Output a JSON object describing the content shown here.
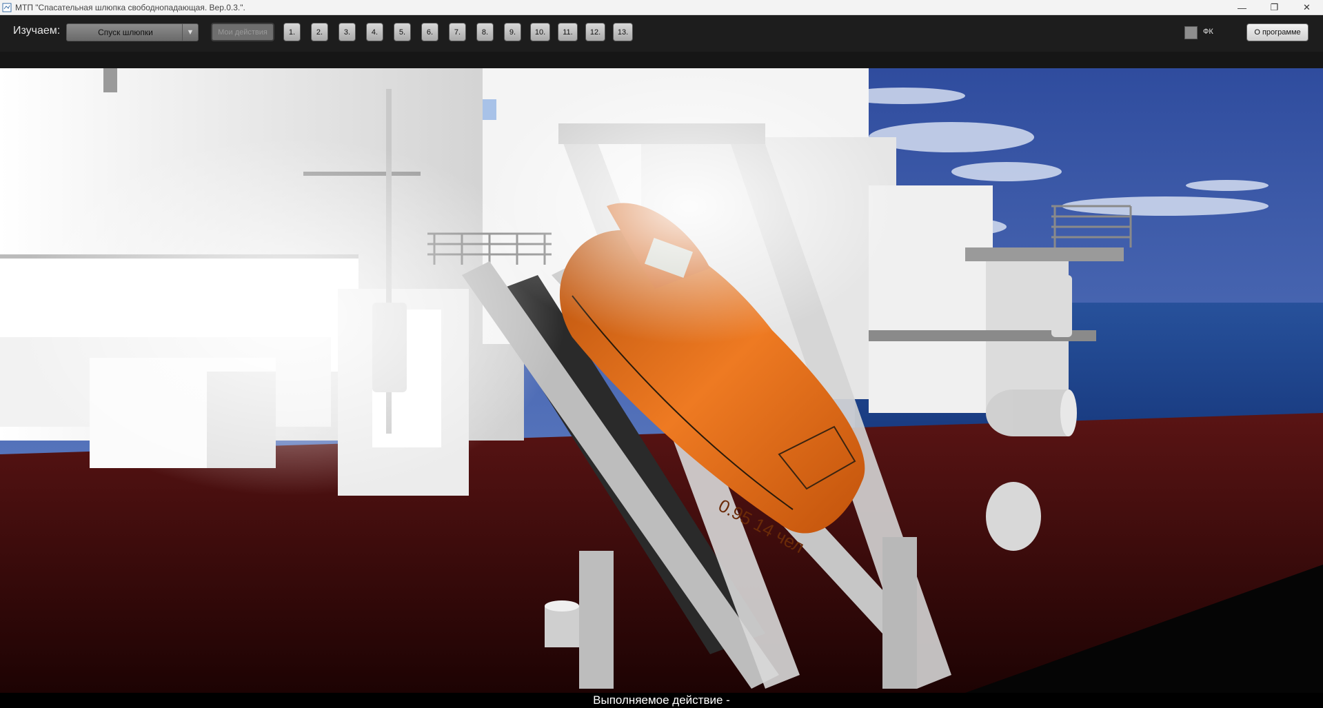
{
  "window": {
    "title": "МТП \"Спасательная шлюпка свободнопадающая. Вер.0.3.\".",
    "minimize_glyph": "—",
    "maximize_glyph": "❐",
    "close_glyph": "✕"
  },
  "toolbar": {
    "study_label": "Изучаем:",
    "scenario_selected": "Спуск шлюпки",
    "dropdown_arrow": "▼",
    "my_actions_label": "Мои действия",
    "steps": [
      "1.",
      "2.",
      "3.",
      "4.",
      "5.",
      "6.",
      "7.",
      "8.",
      "9.",
      "10.",
      "11.",
      "12.",
      "13."
    ],
    "fk_label": "ФК",
    "fk_checked": false,
    "about_label": "О программе"
  },
  "scene": {
    "boat_hull_text": "0.95 14 чел",
    "sky_color": "#3d5ba8",
    "sea_color": "#1a3c86",
    "deck_color": "#3a0a0a",
    "boat_color": "#e06a1c"
  },
  "status": {
    "current_action": "Выполняемое действие -"
  }
}
